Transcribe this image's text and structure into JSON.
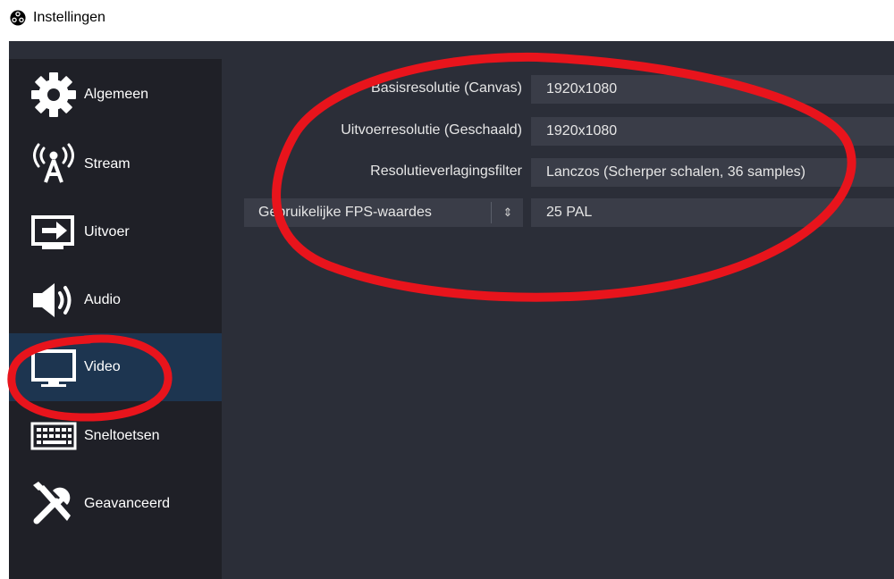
{
  "window": {
    "title": "Instellingen",
    "app_icon": "obs-logo-icon"
  },
  "sidebar": {
    "items": [
      {
        "label": "Algemeen",
        "icon": "gear-icon"
      },
      {
        "label": "Stream",
        "icon": "broadcast-tower-icon"
      },
      {
        "label": "Uitvoer",
        "icon": "output-icon"
      },
      {
        "label": "Audio",
        "icon": "speaker-icon"
      },
      {
        "label": "Video",
        "icon": "monitor-icon"
      },
      {
        "label": "Sneltoetsen",
        "icon": "keyboard-icon"
      },
      {
        "label": "Geavanceerd",
        "icon": "tools-icon"
      }
    ],
    "active": "Video"
  },
  "video": {
    "base_resolution": {
      "label": "Basisresolutie (Canvas)",
      "value": "1920x1080"
    },
    "output_resolution": {
      "label": "Uitvoerresolutie (Geschaald)",
      "value": "1920x1080"
    },
    "downscale_filter": {
      "label": "Resolutieverlagingsfilter",
      "value": "Lanczos (Scherper schalen, 36 samples)"
    },
    "fps": {
      "label": "Gebruikelijke FPS-waardes",
      "value": "25 PAL"
    }
  },
  "colors": {
    "background": "#2b2e38",
    "sidebar": "#1f2027",
    "active_item": "#1d3550",
    "field": "#3a3d48",
    "annotation": "#e8141c"
  }
}
